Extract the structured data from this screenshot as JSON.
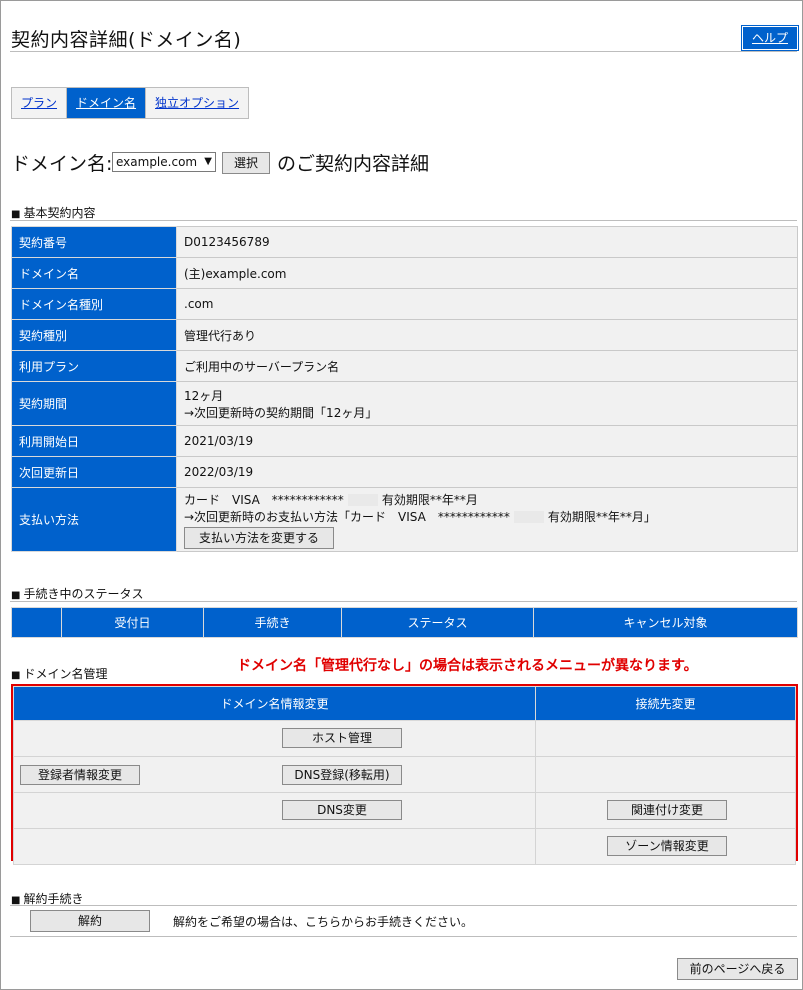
{
  "header": {
    "title": "契約内容詳細(ドメイン名)",
    "help_label": "ヘルプ"
  },
  "tabs": [
    {
      "label": "プラン",
      "active": false
    },
    {
      "label": "ドメイン名",
      "active": true
    },
    {
      "label": "独立オプション",
      "active": false
    }
  ],
  "domain_line": {
    "label": "ドメイン名:",
    "selected_domain": "example.com",
    "select_button": "選択",
    "suffix": "のご契約内容詳細"
  },
  "basic": {
    "section_title": "基本契約内容",
    "rows": [
      {
        "key": "契約番号",
        "value": "D0123456789"
      },
      {
        "key": "ドメイン名",
        "value": "(主)example.com"
      },
      {
        "key": "ドメイン名種別",
        "value": ".com"
      },
      {
        "key": "契約種別",
        "value": "管理代行あり"
      },
      {
        "key": "利用プラン",
        "value": "ご利用中のサーバープラン名"
      },
      {
        "key": "契約期間",
        "value": "12ヶ月",
        "value2": "→次回更新時の契約期間「12ヶ月」"
      },
      {
        "key": "利用開始日",
        "value": "2021/03/19"
      },
      {
        "key": "次回更新日",
        "value": "2022/03/19"
      },
      {
        "key": "支払い方法",
        "line1_a": "カード　VISA　************",
        "line1_b": "有効期限**年**月",
        "line2_a": "→次回更新時のお支払い方法「カード　VISA　************",
        "line2_b": "有効期限**年**月」",
        "button": "支払い方法を変更する"
      }
    ]
  },
  "status": {
    "section_title": "手続き中のステータス",
    "columns": [
      "",
      "受付日",
      "手続き",
      "ステータス",
      "キャンセル対象"
    ]
  },
  "management": {
    "section_title": "ドメイン名管理",
    "warning": "ドメイン名「管理代行なし」の場合は表示されるメニューが異なります。",
    "col_info": "ドメイン名情報変更",
    "col_connect": "接続先変更",
    "host_button": "ホスト管理",
    "registrant_button": "登録者情報変更",
    "dns_register_button": "DNS登録(移転用)",
    "dns_change_button": "DNS変更",
    "link_change_button": "関連付け変更",
    "zone_button": "ゾーン情報変更"
  },
  "cancellation": {
    "section_title": "解約手続き",
    "button": "解約",
    "text": "解約をご希望の場合は、こちらからお手続きください。"
  },
  "footer": {
    "back_button": "前のページへ戻る"
  },
  "colors": {
    "accent_blue": "#0061cc",
    "warning_red": "#e00000",
    "cell_gray": "#f1f1f1"
  }
}
